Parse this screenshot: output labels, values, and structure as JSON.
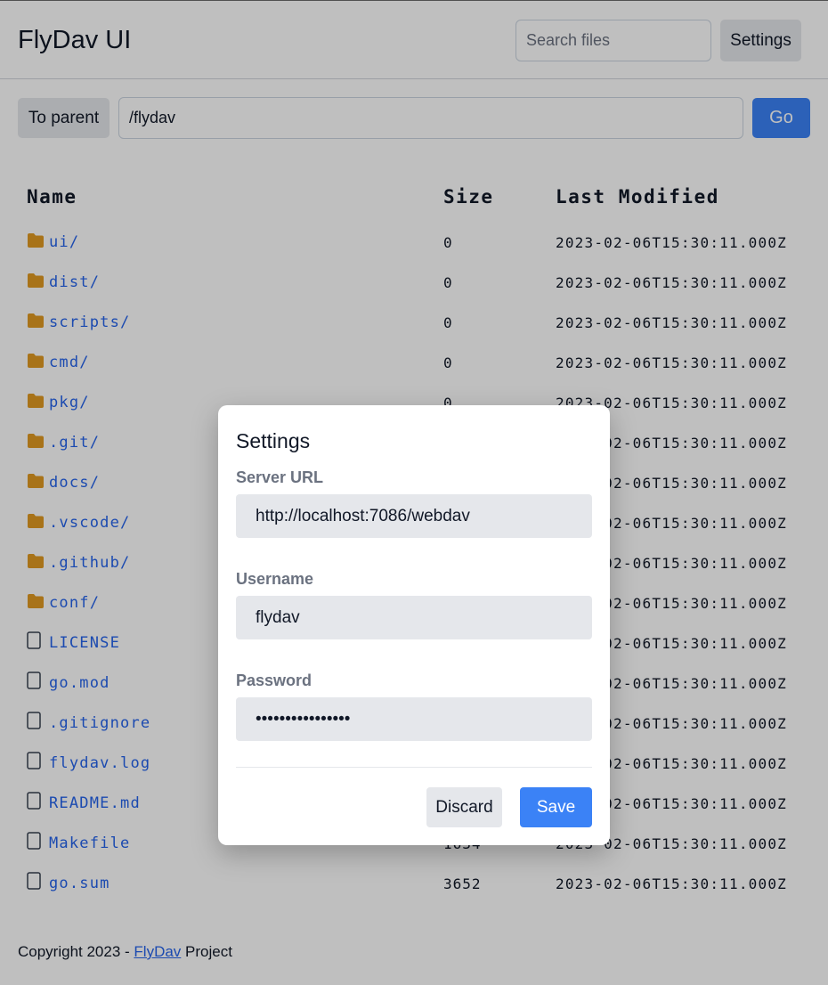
{
  "header": {
    "title": "FlyDav UI",
    "search_placeholder": "Search files",
    "settings_label": "Settings"
  },
  "pathbar": {
    "parent_label": "To parent",
    "path_value": "/flydav",
    "go_label": "Go"
  },
  "table": {
    "columns": [
      "Name",
      "Size",
      "Last Modified"
    ],
    "rows": [
      {
        "name": "ui/",
        "type": "folder",
        "size": "0",
        "modified": "2023-02-06T15:30:11.000Z"
      },
      {
        "name": "dist/",
        "type": "folder",
        "size": "0",
        "modified": "2023-02-06T15:30:11.000Z"
      },
      {
        "name": "scripts/",
        "type": "folder",
        "size": "0",
        "modified": "2023-02-06T15:30:11.000Z"
      },
      {
        "name": "cmd/",
        "type": "folder",
        "size": "0",
        "modified": "2023-02-06T15:30:11.000Z"
      },
      {
        "name": "pkg/",
        "type": "folder",
        "size": "0",
        "modified": "2023-02-06T15:30:11.000Z"
      },
      {
        "name": ".git/",
        "type": "folder",
        "size": "0",
        "modified": "2023-02-06T15:30:11.000Z"
      },
      {
        "name": "docs/",
        "type": "folder",
        "size": "0",
        "modified": "2023-02-06T15:30:11.000Z"
      },
      {
        "name": ".vscode/",
        "type": "folder",
        "size": "0",
        "modified": "2023-02-06T15:30:11.000Z"
      },
      {
        "name": ".github/",
        "type": "folder",
        "size": "0",
        "modified": "2023-02-06T15:30:11.000Z"
      },
      {
        "name": "conf/",
        "type": "folder",
        "size": "0",
        "modified": "2023-02-06T15:30:11.000Z"
      },
      {
        "name": "LICENSE",
        "type": "file",
        "size": "",
        "modified": "2023-02-06T15:30:11.000Z"
      },
      {
        "name": "go.mod",
        "type": "file",
        "size": "",
        "modified": "2023-02-06T15:30:11.000Z"
      },
      {
        "name": ".gitignore",
        "type": "file",
        "size": "",
        "modified": "2023-02-06T15:30:11.000Z"
      },
      {
        "name": "flydav.log",
        "type": "file",
        "size": "",
        "modified": "2023-02-06T15:30:11.000Z"
      },
      {
        "name": "README.md",
        "type": "file",
        "size": "",
        "modified": "2023-02-06T15:30:11.000Z"
      },
      {
        "name": "Makefile",
        "type": "file",
        "size": "1634",
        "modified": "2023-02-06T15:30:11.000Z"
      },
      {
        "name": "go.sum",
        "type": "file",
        "size": "3652",
        "modified": "2023-02-06T15:30:11.000Z"
      }
    ]
  },
  "footer": {
    "prefix": "Copyright 2023 - ",
    "link": "FlyDav",
    "suffix": " Project"
  },
  "modal": {
    "title": "Settings",
    "server_url_label": "Server URL",
    "server_url_value": "http://localhost:7086/webdav",
    "username_label": "Username",
    "username_value": "flydav",
    "password_label": "Password",
    "password_value": "flydavpassword12",
    "discard_label": "Discard",
    "save_label": "Save"
  },
  "colors": {
    "accent": "#3b82f6",
    "link": "#2563eb",
    "folder_icon": "#e09a22",
    "overlay": "rgba(0,0,0,0.25)"
  },
  "icons": {
    "folder": "folder-icon",
    "file": "file-icon"
  }
}
